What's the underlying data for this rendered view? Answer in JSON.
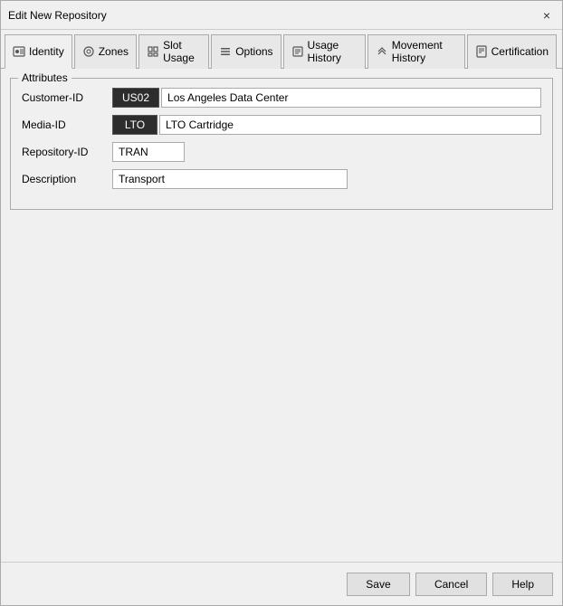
{
  "window": {
    "title": "Edit New Repository",
    "close_label": "×"
  },
  "tabs": [
    {
      "id": "identity",
      "label": "Identity",
      "icon": "id-icon",
      "active": true
    },
    {
      "id": "zones",
      "label": "Zones",
      "icon": "zone-icon",
      "active": false
    },
    {
      "id": "slot-usage",
      "label": "Slot Usage",
      "icon": "slot-icon",
      "active": false
    },
    {
      "id": "options",
      "label": "Options",
      "icon": "options-icon",
      "active": false
    },
    {
      "id": "usage-history",
      "label": "Usage History",
      "icon": "history-icon",
      "active": false
    },
    {
      "id": "movement-history",
      "label": "Movement History",
      "icon": "movement-icon",
      "active": false
    },
    {
      "id": "certification",
      "label": "Certification",
      "icon": "cert-icon",
      "active": false
    }
  ],
  "attributes_group": {
    "legend": "Attributes",
    "fields": [
      {
        "id": "customer-id",
        "label": "Customer-ID",
        "btn_value": "US02",
        "text_value": "Los Angeles Data Center"
      },
      {
        "id": "media-id",
        "label": "Media-ID",
        "btn_value": "LTO",
        "text_value": "LTO Cartridge"
      },
      {
        "id": "repository-id",
        "label": "Repository-ID",
        "input_value": "TRAN"
      },
      {
        "id": "description",
        "label": "Description",
        "input_value": "Transport"
      }
    ]
  },
  "buttons": {
    "save": "Save",
    "cancel": "Cancel",
    "help": "Help"
  }
}
